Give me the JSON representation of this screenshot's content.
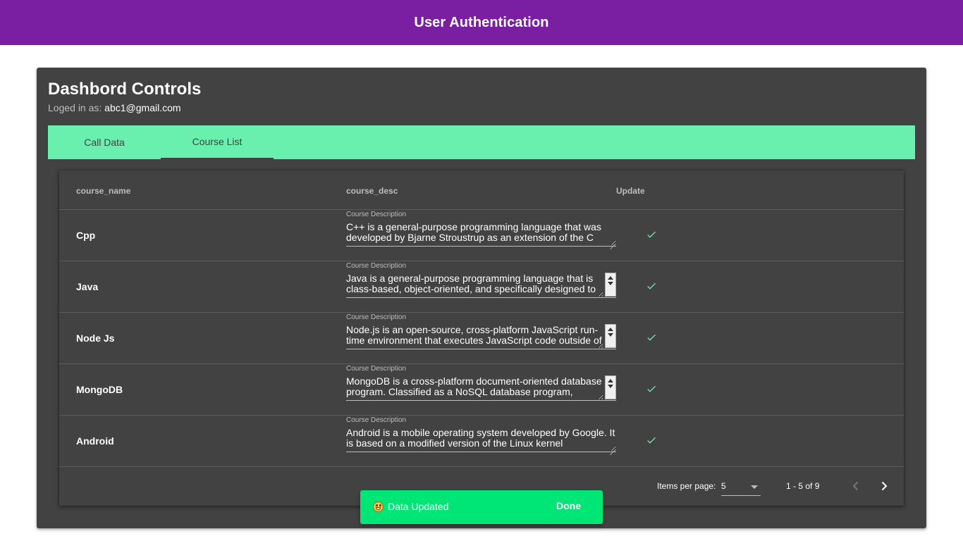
{
  "app": {
    "title": "User Authentication"
  },
  "dashboard": {
    "title": "Dashbord Controls",
    "logged_in_label": "Loged in as: ",
    "email": "abc1@gmail.com"
  },
  "tabs": [
    {
      "label": "Call Data",
      "active": false
    },
    {
      "label": "Course List",
      "active": true
    }
  ],
  "table": {
    "headers": [
      "course_name",
      "course_desc",
      "Update"
    ],
    "field_label": "Course Description",
    "update_icon": "check-icon",
    "rows": [
      {
        "name": "Cpp",
        "desc": "C++ is a general-purpose programming language that was developed by Bjarne Stroustrup as an extension of the C"
      },
      {
        "name": "Java",
        "desc": "Java is a general-purpose programming language that is class-based, object-oriented, and specifically designed to"
      },
      {
        "name": "Node Js",
        "desc": "Node.js is an open-source, cross-platform JavaScript run-time environment that executes JavaScript code outside of"
      },
      {
        "name": "MongoDB",
        "desc": "MongoDB is a cross-platform document-oriented database program. Classified as a NoSQL database program,"
      },
      {
        "name": "Android",
        "desc": "Android is a mobile operating system developed by Google. It is based on a modified version of the Linux kernel"
      }
    ]
  },
  "paginator": {
    "items_per_page_label": "Items per page:",
    "items_per_page": "5",
    "range": "1 - 5 of 9",
    "prev_icon": "chevron-left-icon",
    "next_icon": "chevron-right-icon"
  },
  "snackbar": {
    "icon": "grinning-face-icon",
    "message": "Data Updated",
    "action": "Done"
  },
  "colors": {
    "toolbar": "#7b1fa2",
    "card": "#424242",
    "tab_bar": "#69f0ae",
    "check": "#69f0ae",
    "snackbar": "#00e676"
  }
}
